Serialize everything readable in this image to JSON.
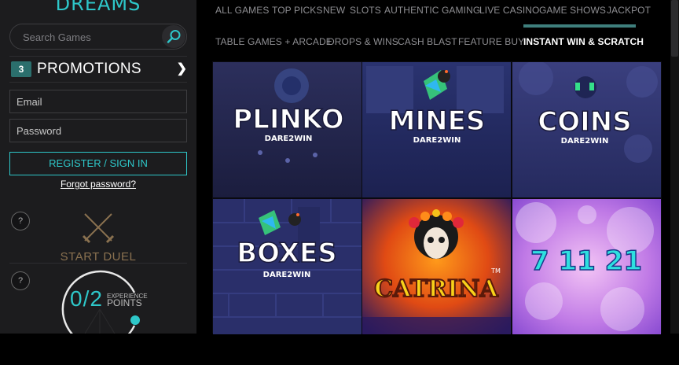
{
  "sidebar": {
    "logo": "DREAMS",
    "search_placeholder": "Search Games",
    "search_icon": "search-icon",
    "promotions": {
      "count": "3",
      "label": "PROMOTIONS",
      "chevron": "❯"
    },
    "email_placeholder": "Email",
    "password_placeholder": "Password",
    "register_label": "REGISTER / SIGN IN",
    "forgot_label": "Forgot password?",
    "help_glyph": "?",
    "duel_label": "START DUEL",
    "xp": {
      "value": "0/2",
      "label_small": "EXPERIENCE",
      "label_big": "POINTS"
    }
  },
  "nav": {
    "row1": [
      "ALL GAMES",
      "TOP PICKS",
      "NEW",
      "SLOTS",
      "AUTHENTIC GAMING",
      "LIVE CASINO",
      "GAME SHOWS",
      "JACKPOT"
    ],
    "row2": [
      "TABLE GAMES + ARCADE",
      "DROPS & WINS",
      "CASH BLAST",
      "FEATURE BUY",
      "INSTANT WIN & SCRATCH"
    ],
    "active": "INSTANT WIN & SCRATCH"
  },
  "games": [
    {
      "title": "PLINKO",
      "subtitle": "DARE2WIN"
    },
    {
      "title": "MINES",
      "subtitle": "DARE2WIN"
    },
    {
      "title": "COINS",
      "subtitle": "DARE2WIN"
    },
    {
      "title": "BOXES",
      "subtitle": "DARE2WIN"
    },
    {
      "title": "CATRINA",
      "subtitle": "TM"
    },
    {
      "title": "7 11 21",
      "subtitle": ""
    }
  ],
  "colors": {
    "accent": "#2ec7c9",
    "sidebar_bg": "#1c1c1e",
    "duel": "#8a7150"
  }
}
